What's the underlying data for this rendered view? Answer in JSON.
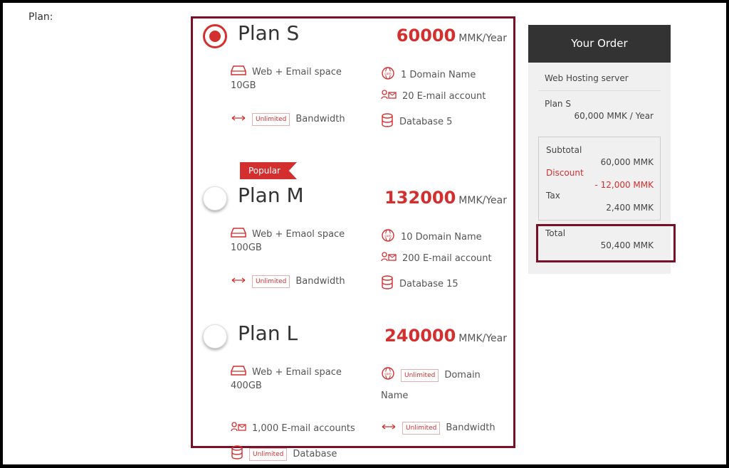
{
  "page": {
    "plan_label": "Plan:"
  },
  "popular_badge": "Popular",
  "plans": [
    {
      "name": "Plan S",
      "price": "60000",
      "unit": "MMK/Year",
      "selected": true,
      "storage": "Web + Email space",
      "storage_size": "10GB",
      "domain": "1 Domain Name",
      "email": "20 E-mail account",
      "unlimited": "Unlimited",
      "bandwidth": "Bandwidth",
      "database": "Database 5"
    },
    {
      "name": "Plan M",
      "price": "132000",
      "unit": "MMK/Year",
      "selected": false,
      "storage": "Web + Emaol space",
      "storage_size": "100GB",
      "domain": "10 Domain Name",
      "email": "200 E-mail account",
      "unlimited": "Unlimited",
      "bandwidth": "Bandwidth",
      "database": "Database 15"
    },
    {
      "name": "Plan L",
      "price": "240000",
      "unit": "MMK/Year",
      "selected": false,
      "storage": "Web + Email space",
      "storage_size": "400GB",
      "unlimited": "Unlimited",
      "domain_word": "Domain",
      "domain_name": "Name",
      "email": "1,000 E-mail accounts",
      "bandwidth": "Bandwidth",
      "database": "Database"
    }
  ],
  "order": {
    "title": "Your Order",
    "server": "Web Hosting server",
    "plan": "Plan S",
    "plan_price": "60,000 MMK / Year",
    "subtotal_label": "Subtotal",
    "subtotal": "60,000 MMK",
    "discount_label": "Discount",
    "discount": "- 12,000 MMK",
    "tax_label": "Tax",
    "tax": "2,400 MMK",
    "total_label": "Total",
    "total": "50,400 MMK"
  },
  "colors": {
    "accent": "#d32f2f",
    "highlight_border": "#7a1027",
    "order_header": "#333333"
  },
  "icons": [
    "radio-selected",
    "radio-unselected",
    "server-icon",
    "globe-com-icon",
    "email-account-icon",
    "bandwidth-arrows-icon",
    "database-icon"
  ]
}
